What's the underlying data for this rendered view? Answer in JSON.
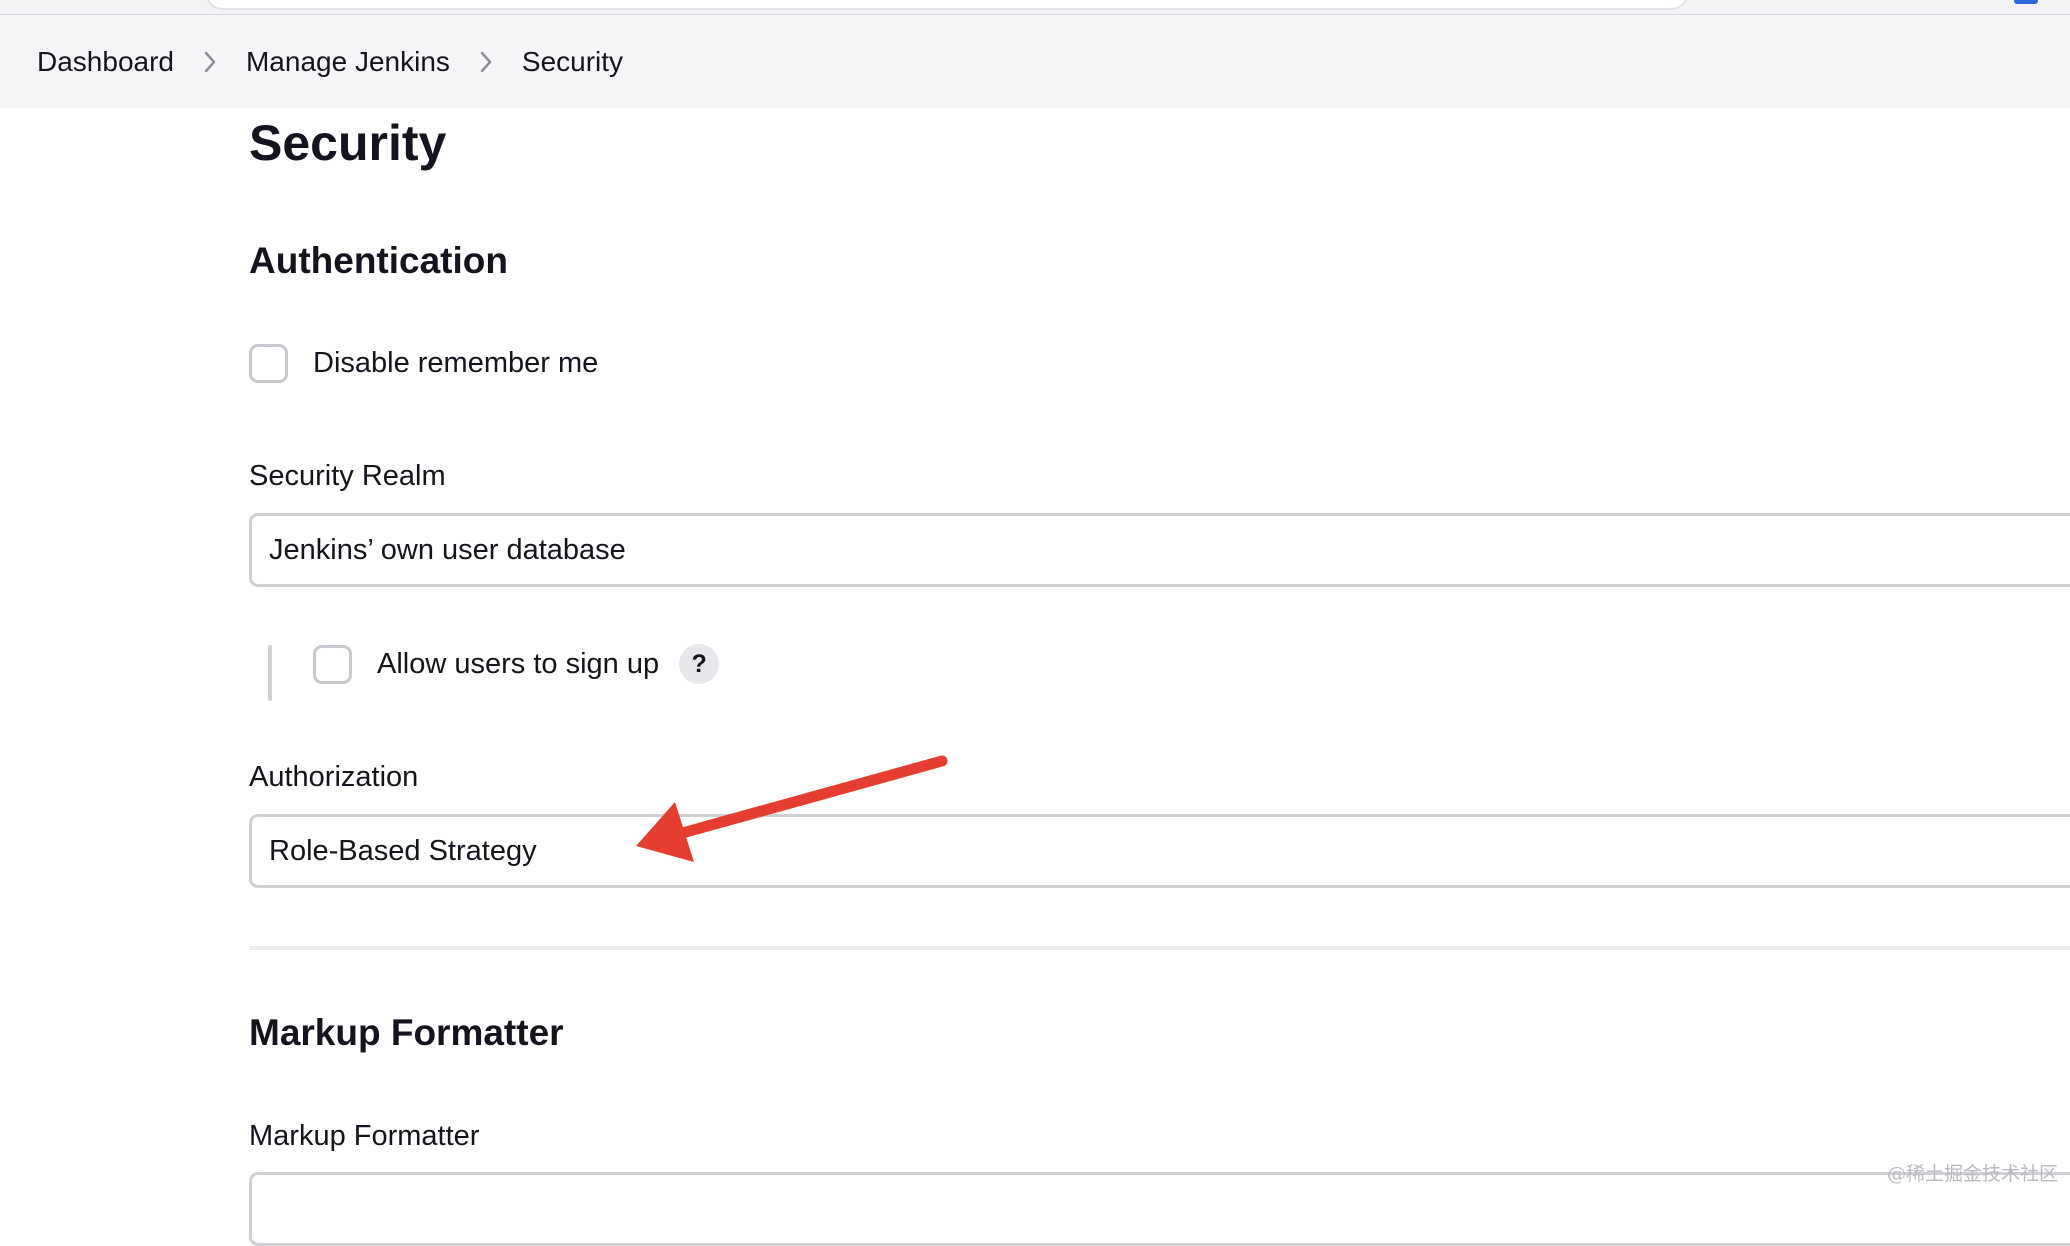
{
  "breadcrumb": {
    "items": [
      {
        "label": "Dashboard"
      },
      {
        "label": "Manage Jenkins"
      },
      {
        "label": "Security"
      }
    ]
  },
  "page": {
    "title": "Security"
  },
  "authentication": {
    "heading": "Authentication",
    "disable_remember_me": {
      "label": "Disable remember me",
      "checked": false
    },
    "security_realm": {
      "label": "Security Realm",
      "value": "Jenkins’ own user database"
    },
    "allow_signup": {
      "label": "Allow users to sign up",
      "checked": false,
      "help": "?"
    },
    "authorization": {
      "label": "Authorization",
      "value": "Role-Based Strategy"
    }
  },
  "markup_formatter": {
    "heading": "Markup Formatter",
    "field_label": "Markup Formatter",
    "value": ""
  },
  "annotation": {
    "arrow_color": "#e53d2f",
    "points_to": "authorization-select"
  },
  "colors": {
    "breadcrumb_bg": "#f6f6f9",
    "text": "#14141f",
    "input_border": "#cfcfd4"
  },
  "watermark": "@稀土掘金技术社区"
}
